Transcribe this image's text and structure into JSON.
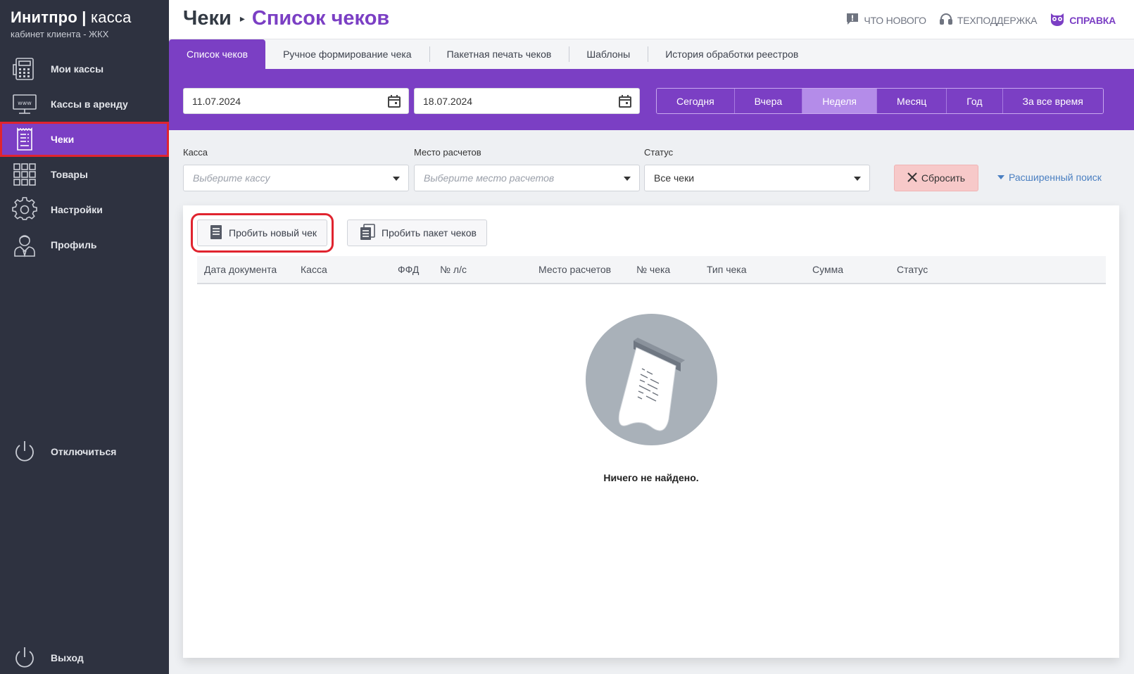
{
  "brand": {
    "title_bold": "Инитпро",
    "title_sep": "|",
    "title_light": "касса",
    "subtitle": "кабинет клиента - ЖКХ"
  },
  "sidebar": {
    "items": [
      {
        "label": "Мои кассы",
        "icon": "cash-register-icon"
      },
      {
        "label": "Кассы в аренду",
        "icon": "www-monitor-icon"
      },
      {
        "label": "Чеки",
        "icon": "receipt-icon",
        "active": true
      },
      {
        "label": "Товары",
        "icon": "grid-icon"
      },
      {
        "label": "Настройки",
        "icon": "gear-icon"
      },
      {
        "label": "Профиль",
        "icon": "user-icon"
      }
    ],
    "disconnect_label": "Отключиться",
    "exit_label": "Выход"
  },
  "header": {
    "breadcrumb_root": "Чеки",
    "breadcrumb_current": "Список чеков",
    "links": {
      "whats_new": "Что нового",
      "support": "Техподдержка",
      "help": "Справка"
    }
  },
  "tabs": [
    "Список чеков",
    "Ручное формирование чека",
    "Пакетная печать чеков",
    "Шаблоны",
    "История обработки реестров"
  ],
  "dates": {
    "from": "11.07.2024",
    "to": "18.07.2024"
  },
  "periods": [
    "Сегодня",
    "Вчера",
    "Неделя",
    "Месяц",
    "Год",
    "За все время"
  ],
  "active_period": "Неделя",
  "filters": {
    "kassa_label": "Касса",
    "kassa_placeholder": "Выберите кассу",
    "place_label": "Место расчетов",
    "place_placeholder": "Выберите место расчетов",
    "status_label": "Статус",
    "status_value": "Все чеки",
    "reset_label": "Сбросить",
    "advanced_label": "Расширенный поиск"
  },
  "actions": {
    "new_receipt": "Пробить новый чек",
    "batch_receipt": "Пробить пакет чеков"
  },
  "table": {
    "columns": [
      "Дата документа",
      "Касса",
      "ФФД",
      "№ л/с",
      "Место расчетов",
      "№ чека",
      "Тип чека",
      "Сумма",
      "Статус"
    ],
    "empty_text": "Ничего не найдено."
  },
  "colors": {
    "accent": "#7b3fc4",
    "sidebar_bg": "#2e3240",
    "highlight": "#e0242f",
    "reset_bg": "#f7c9c9",
    "link": "#4a7fc1"
  }
}
